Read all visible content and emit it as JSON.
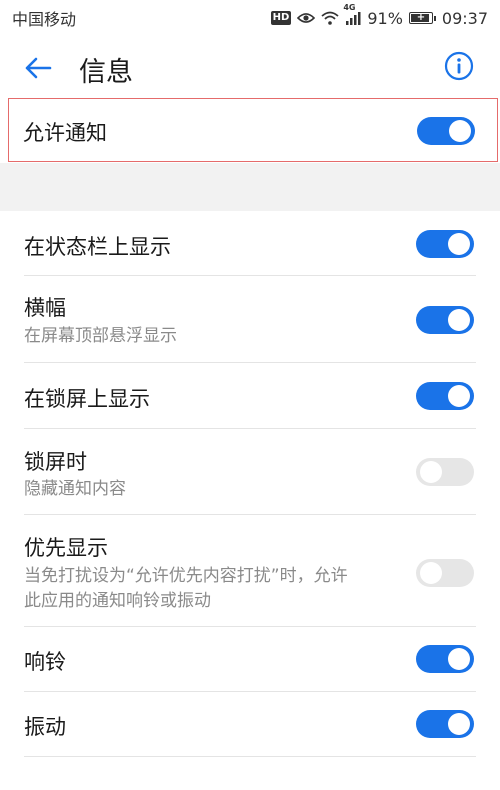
{
  "status_bar": {
    "carrier": "中国移动",
    "hd": "HD",
    "network": "4G",
    "battery_percent": "91%",
    "time": "09:37",
    "icons": [
      "eye-icon",
      "wifi-icon",
      "signal-icon",
      "battery-icon"
    ]
  },
  "header": {
    "title": "信息",
    "back_icon": "arrow-left-icon",
    "info_icon": "info-icon"
  },
  "colors": {
    "accent": "#1a73e8",
    "toggle_off": "#e6e6e6",
    "highlight_border": "#e56b6b",
    "section_gap": "#f2f2f2"
  },
  "allow_notifications": {
    "label": "允许通知",
    "enabled": true
  },
  "settings": [
    {
      "title": "在状态栏上显示",
      "subtitle": "",
      "enabled": true
    },
    {
      "title": "横幅",
      "subtitle": "在屏幕顶部悬浮显示",
      "enabled": true
    },
    {
      "title": "在锁屏上显示",
      "subtitle": "",
      "enabled": true
    },
    {
      "title": "锁屏时",
      "subtitle": "隐藏通知内容",
      "enabled": false
    },
    {
      "title": "优先显示",
      "subtitle": "当免打扰设为“允许优先内容打扰”时，允许此应用的通知响铃或振动",
      "enabled": false
    },
    {
      "title": "响铃",
      "subtitle": "",
      "enabled": true
    },
    {
      "title": "振动",
      "subtitle": "",
      "enabled": true
    }
  ]
}
